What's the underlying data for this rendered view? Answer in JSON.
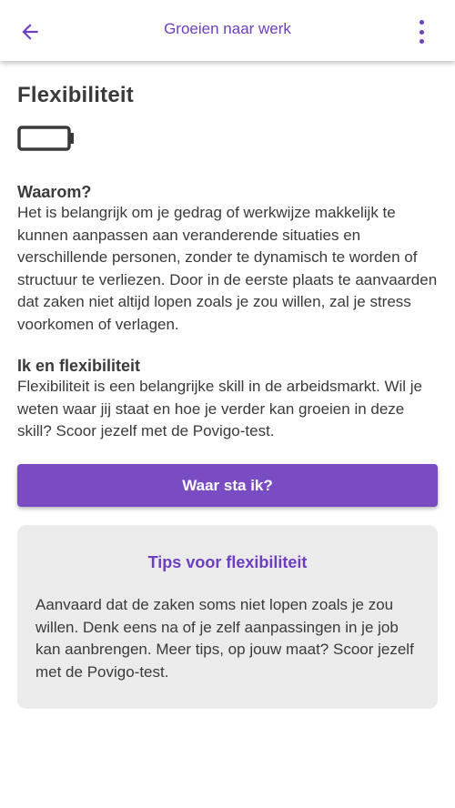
{
  "header": {
    "title": "Groeien naar werk",
    "back_icon": "arrow-left-icon",
    "more_icon": "more-vertical-icon",
    "accent_color": "#6d3fc0"
  },
  "page": {
    "title": "Flexibiliteit",
    "level_icon": "battery-empty-icon"
  },
  "why": {
    "title": "Waarom?",
    "text": "Het is belangrijk om je gedrag of werkwijze makkelijk te kunnen aanpassen aan veranderende situaties en verschillende personen, zonder te dynamisch te worden of structuur te verliezen. Door in de eerste plaats te aanvaarden dat zaken niet altijd lopen zoals je zou willen, zal je stress voorkomen of verlagen."
  },
  "me": {
    "title": "Ik en flexibiliteit",
    "text": "Flexibiliteit is een belangrijke skill in de arbeidsmarkt. Wil je weten waar jij staat en hoe je verder kan groeien in deze skill? Scoor jezelf met de Povigo-test."
  },
  "cta": {
    "label": "Waar sta ik?",
    "color": "#7a4cc4"
  },
  "tips": {
    "title": "Tips voor flexibiliteit",
    "text": "Aanvaard dat de zaken soms niet lopen zoals je zou willen. Denk eens na of je zelf aanpassingen in je job kan aanbrengen. Meer tips, op jouw maat? Scoor jezelf met de Povigo-test."
  }
}
